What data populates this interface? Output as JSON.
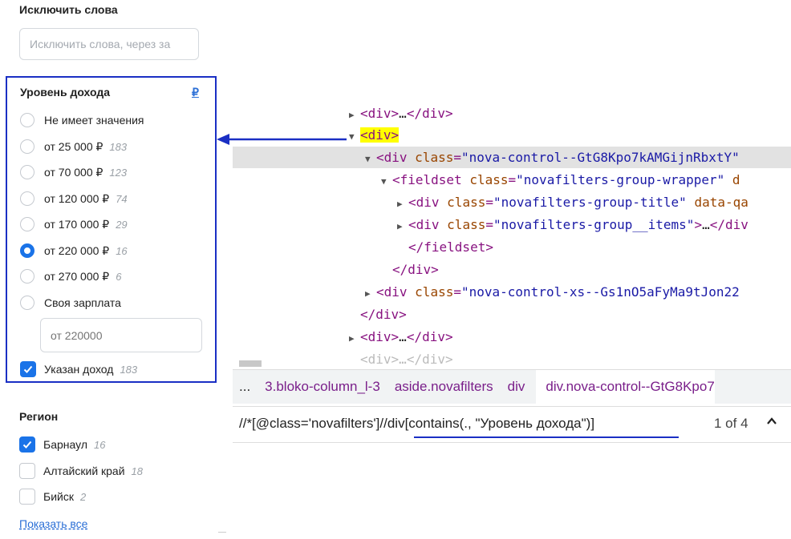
{
  "exclude": {
    "title": "Исключить слова",
    "placeholder": "Исключить слова, через за"
  },
  "income": {
    "title": "Уровень дохода",
    "currency": "₽",
    "options": [
      {
        "label": "Не имеет значения",
        "count": ""
      },
      {
        "label": "от 25 000 ₽",
        "count": "183"
      },
      {
        "label": "от 70 000 ₽",
        "count": "123"
      },
      {
        "label": "от 120 000 ₽",
        "count": "74"
      },
      {
        "label": "от 170 000 ₽",
        "count": "29"
      },
      {
        "label": "от 220 000 ₽",
        "count": "16"
      },
      {
        "label": "от 270 000 ₽",
        "count": "6"
      },
      {
        "label": "Своя зарплата",
        "count": ""
      }
    ],
    "selected_index": 5,
    "salary_placeholder": "от 220000",
    "specified": {
      "label": "Указан доход",
      "count": "183"
    }
  },
  "region": {
    "title": "Регион",
    "items": [
      {
        "label": "Барнаул",
        "count": "16",
        "checked": true
      },
      {
        "label": "Алтайский край",
        "count": "18",
        "checked": false
      },
      {
        "label": "Бийск",
        "count": "2",
        "checked": false
      }
    ],
    "show_all": "Показать все"
  },
  "devtools": {
    "dom_lines": [
      {
        "tri": "▶",
        "html": "<span class='tag'>&lt;div&gt;</span>…<span class='tag'>&lt;/div&gt;</span>"
      },
      {
        "tri": "▼",
        "html": "<span class='tag hl'>&lt;div&gt;</span>"
      },
      {
        "tri": "▼",
        "html": "<span class='tag'>&lt;div</span> <span class='attr'>class</span><span class='tag'>=</span><span class='val'>\"nova-control--GtG8Kpo7kAMGijnRbxtY\"</span>"
      },
      {
        "tri": "▼",
        "html": "<span class='tag'>&lt;fieldset</span> <span class='attr'>class</span><span class='tag'>=</span><span class='val'>\"novafilters-group-wrapper\"</span> <span class='attr'>d</span>"
      },
      {
        "tri": "▶",
        "html": "<span class='tag'>&lt;div</span> <span class='attr'>class</span><span class='tag'>=</span><span class='val'>\"novafilters-group-title\"</span> <span class='attr'>data-qa</span>"
      },
      {
        "tri": "▶",
        "html": "<span class='tag'>&lt;div</span> <span class='attr'>class</span><span class='tag'>=</span><span class='val'>\"novafilters-group__items\"</span><span class='tag'>&gt;</span>…<span class='tag'>&lt;/div</span>"
      },
      {
        "tri": "",
        "html": "<span class='tag'>&lt;/fieldset&gt;</span>"
      },
      {
        "tri": "",
        "html": "<span class='tag'>&lt;/div&gt;</span>"
      },
      {
        "tri": "▶",
        "html": "<span class='tag'>&lt;div</span> <span class='attr'>class</span><span class='tag'>=</span><span class='val'>\"nova-control-xs--Gs1nO5aFyMa9tJon22</span>"
      },
      {
        "tri": "",
        "html": "<span class='tag'>&lt;/div&gt;</span>"
      },
      {
        "tri": "▶",
        "html": "<span class='tag'>&lt;div&gt;</span>…<span class='tag'>&lt;/div&gt;</span>"
      },
      {
        "tri": "",
        "html": "<span class='tag dim'>&lt;div&gt;</span><span class='dim'>…</span><span class='tag dim'>&lt;/div&gt;</span>"
      }
    ],
    "crumbs": {
      "ellipsis": "...",
      "c1": "3.bloko-column_l-3",
      "c2": "aside.novafilters",
      "c3": "div",
      "c4": "div.nova-control--GtG8Kpo7"
    },
    "xpath": "//*[@class='novafilters']//div[contains(., \"Уровень дохода\")]",
    "match_count": "1 of 4",
    "up_button": "^"
  }
}
